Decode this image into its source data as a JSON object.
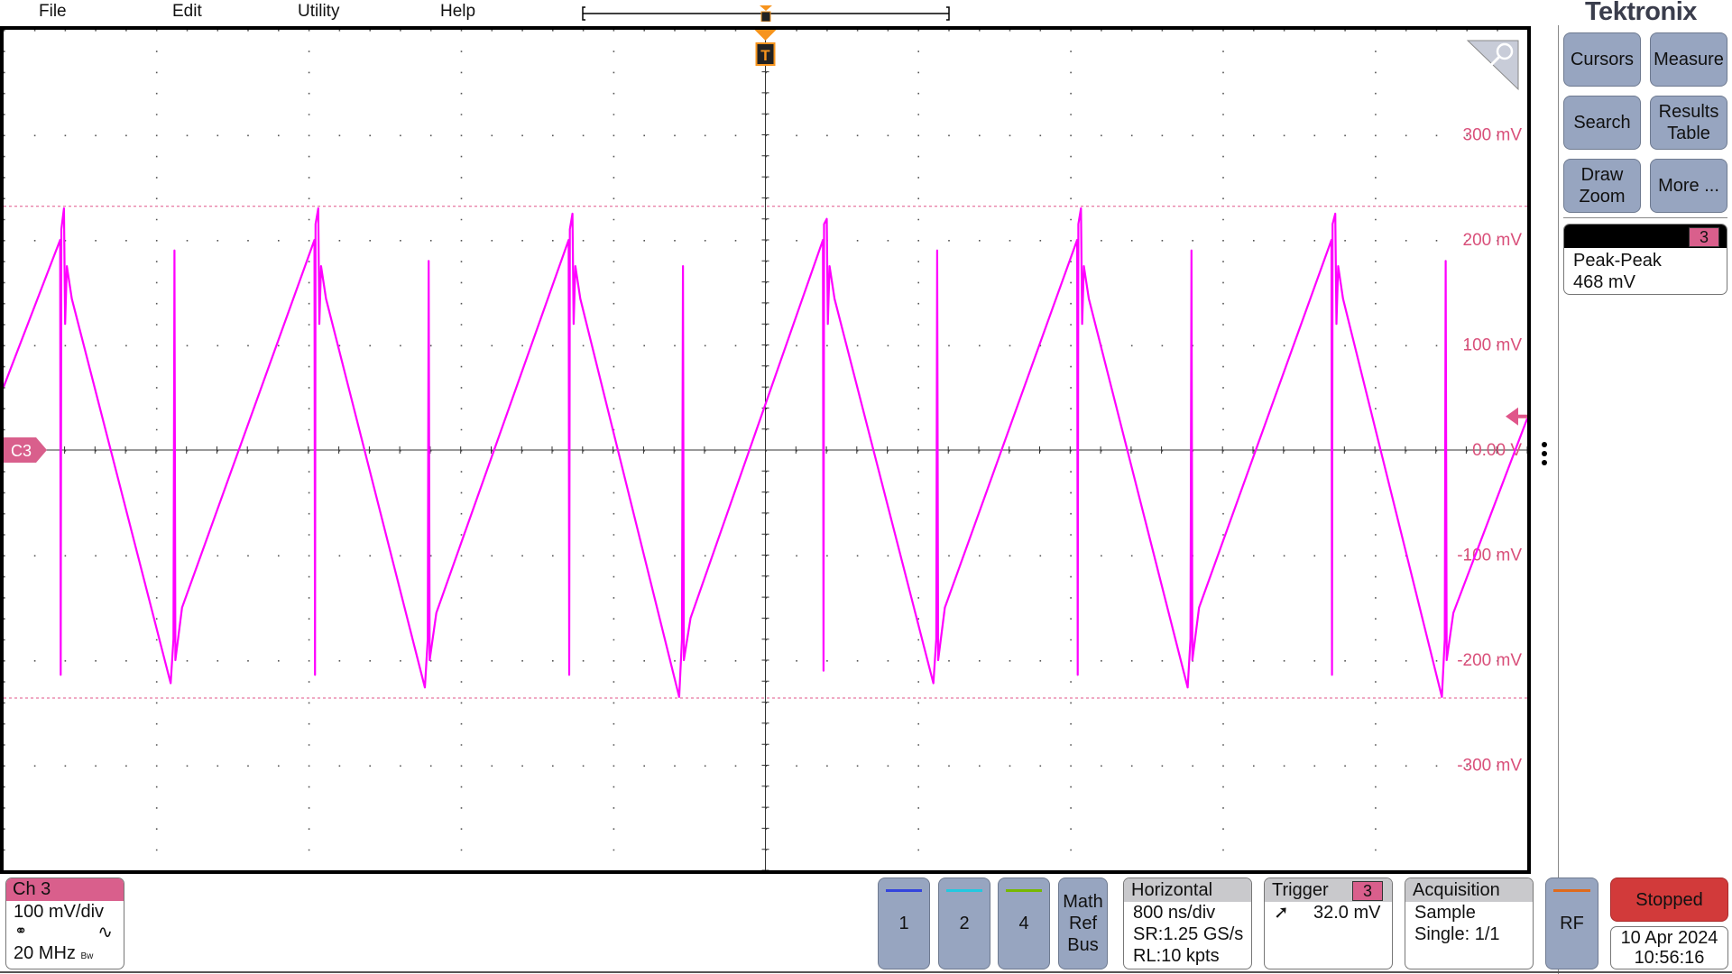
{
  "menu": {
    "items": [
      "File",
      "Edit",
      "Utility",
      "Help"
    ]
  },
  "brand": {
    "logo": "Tektronix"
  },
  "colors": {
    "ch3": "#ff00ff",
    "ch3_label": "#d95f8c",
    "trigger": "#f7941d",
    "ch1": "#3344dd",
    "ch2": "#22c8e0",
    "ch4": "#77b800",
    "rf": "#e06a1c",
    "stopped": "#d23a3a",
    "button": "#97a5c0"
  },
  "plot": {
    "channel_marker": "C3",
    "trigger_marker": "T",
    "y_labels": [
      "300 mV",
      "200 mV",
      "100 mV",
      "0.00 V",
      "-100 mV",
      "-200 mV",
      "-300 mV"
    ]
  },
  "chart_data": {
    "type": "line",
    "xlim": [
      -4000,
      4000
    ],
    "x_unit": "ns",
    "ylim": [
      -400,
      400
    ],
    "y_unit": "mV",
    "y_ticks": [
      300,
      200,
      100,
      0,
      -100,
      -200,
      -300
    ],
    "grid": true,
    "measurement_lines_mV": [
      232,
      -236
    ],
    "trigger_level_mV": 32.0,
    "series": [
      {
        "color": "#ff00ff",
        "points": [
          [
            -4000,
            60
          ],
          [
            -3703,
            200
          ],
          [
            -3700,
            -214
          ],
          [
            -3697,
            210
          ],
          [
            -3683,
            230
          ],
          [
            -3677,
            120
          ],
          [
            -3668,
            175
          ],
          [
            -3642,
            144
          ],
          [
            -3123,
            -222
          ],
          [
            -3108,
            -180
          ],
          [
            -3103,
            190
          ],
          [
            -3098,
            -200
          ],
          [
            -3063,
            -150
          ],
          [
            -2368,
            200
          ],
          [
            -2365,
            -214
          ],
          [
            -2362,
            215
          ],
          [
            -2348,
            230
          ],
          [
            -2342,
            120
          ],
          [
            -2333,
            175
          ],
          [
            -2307,
            144
          ],
          [
            -1788,
            -226
          ],
          [
            -1773,
            -180
          ],
          [
            -1768,
            180
          ],
          [
            -1763,
            -200
          ],
          [
            -1728,
            -155
          ],
          [
            -1033,
            200
          ],
          [
            -1030,
            -214
          ],
          [
            -1027,
            210
          ],
          [
            -1013,
            225
          ],
          [
            -1007,
            120
          ],
          [
            -998,
            175
          ],
          [
            -972,
            144
          ],
          [
            -453,
            -235
          ],
          [
            -438,
            -180
          ],
          [
            -433,
            175
          ],
          [
            -428,
            -200
          ],
          [
            -393,
            -160
          ],
          [
            302,
            200
          ],
          [
            305,
            -210
          ],
          [
            308,
            215
          ],
          [
            322,
            220
          ],
          [
            328,
            120
          ],
          [
            337,
            175
          ],
          [
            363,
            144
          ],
          [
            882,
            -222
          ],
          [
            897,
            -180
          ],
          [
            902,
            190
          ],
          [
            907,
            -200
          ],
          [
            942,
            -150
          ],
          [
            1637,
            200
          ],
          [
            1640,
            -214
          ],
          [
            1643,
            215
          ],
          [
            1657,
            230
          ],
          [
            1663,
            120
          ],
          [
            1672,
            175
          ],
          [
            1698,
            144
          ],
          [
            2217,
            -226
          ],
          [
            2232,
            -180
          ],
          [
            2237,
            190
          ],
          [
            2242,
            -200
          ],
          [
            2277,
            -150
          ],
          [
            2972,
            200
          ],
          [
            2975,
            -214
          ],
          [
            2978,
            215
          ],
          [
            2992,
            225
          ],
          [
            2998,
            120
          ],
          [
            3007,
            175
          ],
          [
            3033,
            144
          ],
          [
            3552,
            -235
          ],
          [
            3567,
            -180
          ],
          [
            3572,
            180
          ],
          [
            3577,
            -200
          ],
          [
            3612,
            -155
          ],
          [
            4000,
            30
          ]
        ]
      }
    ]
  },
  "side_buttons": [
    {
      "label": "Cursors"
    },
    {
      "label": "Measure"
    },
    {
      "label": "Search"
    },
    {
      "label": "Results Table"
    },
    {
      "label": "Draw Zoom"
    },
    {
      "label": "More ..."
    }
  ],
  "measurement": {
    "source": "3",
    "name": "Peak-Peak",
    "value": "468 mV"
  },
  "ch3": {
    "title": "Ch 3",
    "scale": "100 mV/div",
    "bandwidth": "20 MHz",
    "bw_symbol": "Bw"
  },
  "channel_buttons": [
    "1",
    "2",
    "4"
  ],
  "math_button": [
    "Math",
    "Ref",
    "Bus"
  ],
  "horizontal": {
    "title": "Horizontal",
    "scale": "800 ns/div",
    "sample_rate": "SR:1.25 GS/s",
    "record_length": "RL:10 kpts"
  },
  "trigger": {
    "title": "Trigger",
    "source": "3",
    "level": "32.0 mV"
  },
  "acquisition": {
    "title": "Acquisition",
    "mode": "Sample",
    "state": "Single: 1/1"
  },
  "rf_button": "RF",
  "run_state": "Stopped",
  "datetime": {
    "date": "10 Apr 2024",
    "time": "10:56:16"
  }
}
